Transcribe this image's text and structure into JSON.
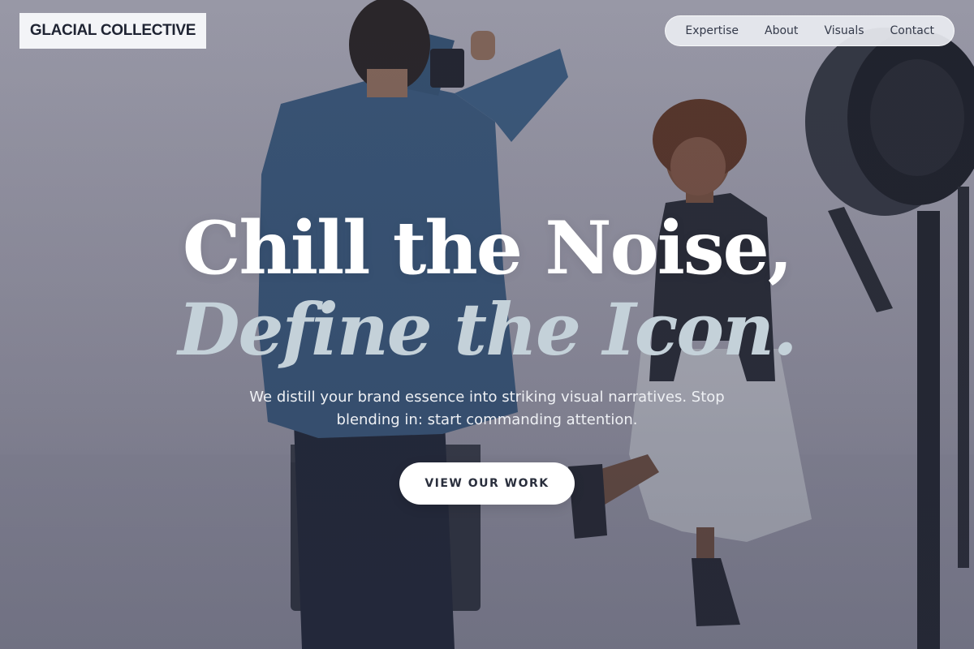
{
  "brand": {
    "name": "GLACIAL COLLECTIVE"
  },
  "nav": {
    "items": [
      {
        "label": "Expertise"
      },
      {
        "label": "About"
      },
      {
        "label": "Visuals"
      },
      {
        "label": "Contact"
      }
    ]
  },
  "hero": {
    "headline": "Chill the Noise,",
    "subheadline": "Define the Icon.",
    "tagline": "We distill your brand essence into striking visual narratives. Stop blending in: start commanding attention.",
    "cta_label": "VIEW OUR WORK"
  },
  "colors": {
    "headline": "#ffffff",
    "subheadline": "#c4d1d9",
    "brand_text": "#1f2433",
    "cta_text": "#2a2f3d"
  }
}
